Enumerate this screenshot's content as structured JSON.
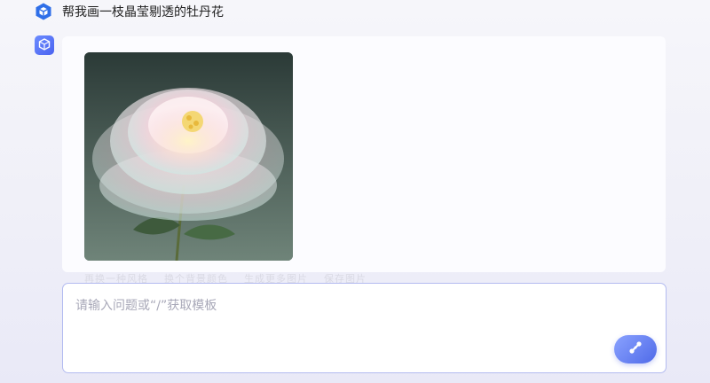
{
  "conversation": {
    "user_message": "帮我画一枝晶莹剔透的牡丹花",
    "faded_suggestions": [
      "再换一种风格",
      "换个背景颜色",
      "生成更多图片",
      "保存图片"
    ]
  },
  "input": {
    "placeholder": "请输入问题或“/”获取模板"
  },
  "icons": {
    "user_avatar": "cube-icon",
    "bot_avatar": "cube-icon",
    "send": "send-icon"
  },
  "colors": {
    "accent": "#5b74f2",
    "input_border": "#b3bbf0"
  }
}
